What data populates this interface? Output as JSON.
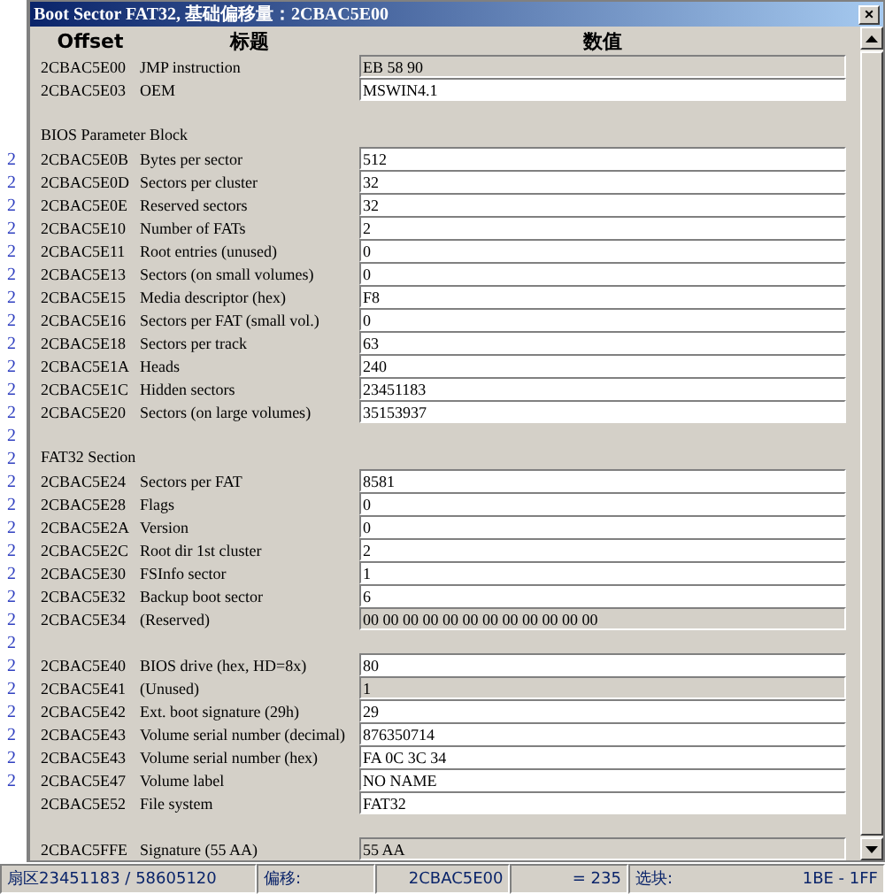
{
  "background_fragments": [
    "2",
    "2",
    "2",
    "2",
    "2",
    "2",
    "2",
    "2",
    "2",
    "2",
    "2",
    "2",
    "2",
    "2",
    "2",
    "2",
    "2",
    "2",
    "2",
    "2",
    "2",
    "2",
    "2",
    "2",
    "2",
    "2",
    "2",
    "2"
  ],
  "window": {
    "title": "Boot Sector FAT32, 基础偏移量：2CBAC5E00",
    "close": "×"
  },
  "columns": [
    "Offset",
    "标题",
    "数值"
  ],
  "groups": [
    {
      "rows": [
        {
          "offset": "2CBAC5E00",
          "title": "JMP instruction",
          "value": "EB 58 90",
          "readonly": true
        },
        {
          "offset": "2CBAC5E03",
          "title": "OEM",
          "value": "MSWIN4.1",
          "readonly": false
        }
      ]
    },
    {
      "heading": "BIOS Parameter Block",
      "rows": [
        {
          "offset": "2CBAC5E0B",
          "title": "Bytes per sector",
          "value": "512",
          "readonly": false
        },
        {
          "offset": "2CBAC5E0D",
          "title": "Sectors per cluster",
          "value": "32",
          "readonly": false
        },
        {
          "offset": "2CBAC5E0E",
          "title": "Reserved sectors",
          "value": "32",
          "readonly": false
        },
        {
          "offset": "2CBAC5E10",
          "title": "Number of FATs",
          "value": "2",
          "readonly": false
        },
        {
          "offset": "2CBAC5E11",
          "title": "Root entries (unused)",
          "value": "0",
          "readonly": false
        },
        {
          "offset": "2CBAC5E13",
          "title": "Sectors (on small volumes)",
          "value": "0",
          "readonly": false
        },
        {
          "offset": "2CBAC5E15",
          "title": "Media descriptor (hex)",
          "value": "F8",
          "readonly": false
        },
        {
          "offset": "2CBAC5E16",
          "title": "Sectors per FAT (small vol.)",
          "value": "0",
          "readonly": false
        },
        {
          "offset": "2CBAC5E18",
          "title": "Sectors per track",
          "value": "63",
          "readonly": false
        },
        {
          "offset": "2CBAC5E1A",
          "title": "Heads",
          "value": "240",
          "readonly": false
        },
        {
          "offset": "2CBAC5E1C",
          "title": "Hidden sectors",
          "value": "23451183",
          "readonly": false
        },
        {
          "offset": "2CBAC5E20",
          "title": "Sectors (on large volumes)",
          "value": "35153937",
          "readonly": false
        }
      ]
    },
    {
      "heading": "FAT32 Section",
      "rows": [
        {
          "offset": "2CBAC5E24",
          "title": "Sectors per FAT",
          "value": "8581",
          "readonly": false
        },
        {
          "offset": "2CBAC5E28",
          "title": "Flags",
          "value": "0",
          "readonly": false
        },
        {
          "offset": "2CBAC5E2A",
          "title": "Version",
          "value": "0",
          "readonly": false
        },
        {
          "offset": "2CBAC5E2C",
          "title": "Root dir 1st cluster",
          "value": "2",
          "readonly": false
        },
        {
          "offset": "2CBAC5E30",
          "title": "FSInfo sector",
          "value": "1",
          "readonly": false
        },
        {
          "offset": "2CBAC5E32",
          "title": "Backup boot sector",
          "value": "6",
          "readonly": false
        },
        {
          "offset": "2CBAC5E34",
          "title": "(Reserved)",
          "value": "00 00 00 00 00 00 00 00 00 00 00 00",
          "readonly": true
        }
      ]
    },
    {
      "rows": [
        {
          "offset": "2CBAC5E40",
          "title": "BIOS drive (hex, HD=8x)",
          "value": "80",
          "readonly": false
        },
        {
          "offset": "2CBAC5E41",
          "title": "(Unused)",
          "value": "1",
          "readonly": true
        },
        {
          "offset": "2CBAC5E42",
          "title": "Ext. boot signature (29h)",
          "value": "29",
          "readonly": false
        },
        {
          "offset": "2CBAC5E43",
          "title": "Volume serial number (decimal)",
          "value": "876350714",
          "readonly": false
        },
        {
          "offset": "2CBAC5E43",
          "title": "Volume serial number (hex)",
          "value": "FA 0C 3C 34",
          "readonly": false
        },
        {
          "offset": "2CBAC5E47",
          "title": "Volume label",
          "value": "NO NAME",
          "readonly": false
        },
        {
          "offset": "2CBAC5E52",
          "title": "File system",
          "value": "FAT32",
          "readonly": false
        }
      ]
    },
    {
      "rows": [
        {
          "offset": "2CBAC5FFE",
          "title": "Signature (55 AA)",
          "value": "55 AA",
          "readonly": true
        }
      ]
    }
  ],
  "status_bar": {
    "sector": "扇区23451183 / 58605120",
    "offset_label": "偏移:",
    "offset": "2CBAC5E00",
    "equals": "= 235",
    "block_label": "选块:",
    "block": "1BE - 1FF"
  }
}
